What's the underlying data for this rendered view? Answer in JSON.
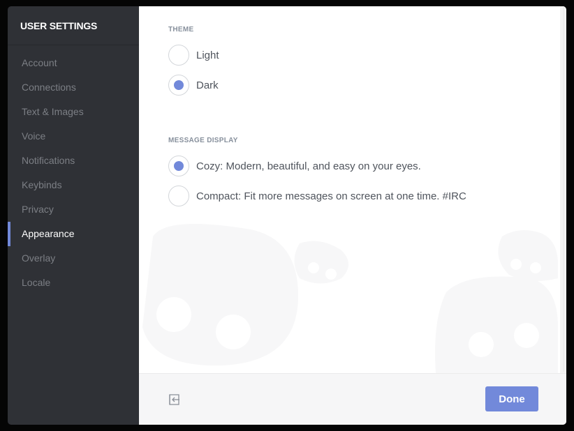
{
  "sidebar": {
    "title": "USER SETTINGS",
    "items": [
      {
        "label": "Account",
        "active": false
      },
      {
        "label": "Connections",
        "active": false
      },
      {
        "label": "Text & Images",
        "active": false
      },
      {
        "label": "Voice",
        "active": false
      },
      {
        "label": "Notifications",
        "active": false
      },
      {
        "label": "Keybinds",
        "active": false
      },
      {
        "label": "Privacy",
        "active": false
      },
      {
        "label": "Appearance",
        "active": true
      },
      {
        "label": "Overlay",
        "active": false
      },
      {
        "label": "Locale",
        "active": false
      }
    ]
  },
  "theme": {
    "title": "THEME",
    "options": [
      {
        "label": "Light",
        "checked": false
      },
      {
        "label": "Dark",
        "checked": true
      }
    ]
  },
  "message_display": {
    "title": "MESSAGE DISPLAY",
    "options": [
      {
        "label": "Cozy: Modern, beautiful, and easy on your eyes.",
        "checked": true
      },
      {
        "label": "Compact: Fit more messages on screen at one time. #IRC",
        "checked": false
      }
    ]
  },
  "footer": {
    "exit_icon": "exit-icon",
    "done_label": "Done"
  },
  "colors": {
    "accent": "#7289da",
    "sidebar_bg": "#2f3136",
    "inactive_text": "#7c7f85"
  }
}
